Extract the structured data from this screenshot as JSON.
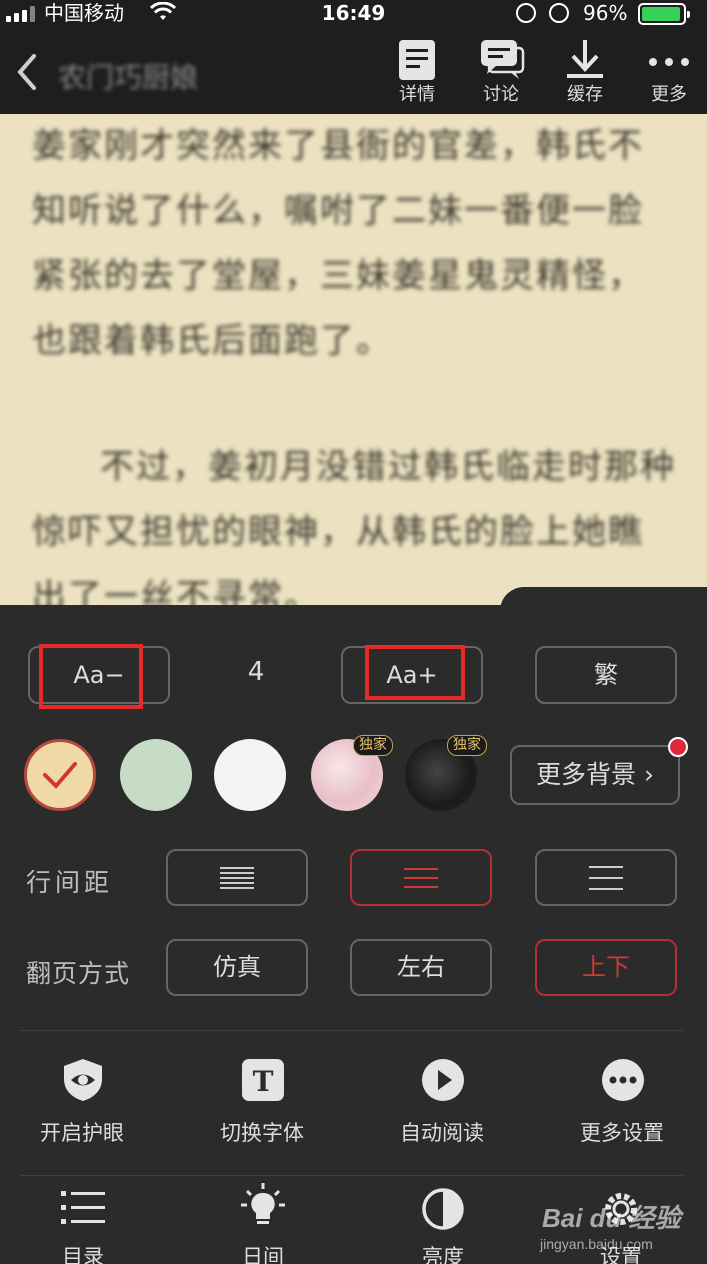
{
  "status_bar": {
    "carrier": "中国移动",
    "time": "16:49",
    "battery_percent_text": "96%",
    "battery_level": 0.96
  },
  "navbar": {
    "title": "农门巧厨娘",
    "actions": [
      {
        "icon": "details-icon",
        "label": "详情"
      },
      {
        "icon": "discussion-icon",
        "label": "讨论"
      },
      {
        "icon": "download-icon",
        "label": "缓存"
      },
      {
        "icon": "more-icon",
        "label": "更多"
      }
    ]
  },
  "page": {
    "paragraphs": [
      "姜家刚才突然来了县衙的官差，韩氏不知听说了什么，嘱咐了二妹一番便一脸紧张的去了堂屋，三妹姜星鬼灵精怪，也跟着韩氏后面跑了。",
      "不过，姜初月没错过韩氏临走时那种惊吓又担忧的眼神，从韩氏的脸上她瞧出了一丝不寻常。"
    ]
  },
  "font_size": {
    "decrease_label": "Aa−",
    "value": "4",
    "increase_label": "Aa+",
    "traditional_label": "繁"
  },
  "backgrounds": {
    "swatches": [
      {
        "name": "parchment",
        "color": "#efd9a7",
        "selected": true
      },
      {
        "name": "green",
        "color": "#c7dcc6",
        "selected": false
      },
      {
        "name": "white",
        "color": "#f4f4f4",
        "selected": false
      },
      {
        "name": "pink-floral",
        "color": "#f2d4d8",
        "selected": false,
        "badge": "独家"
      },
      {
        "name": "dark",
        "color": "#242424",
        "selected": false,
        "badge": "独家"
      }
    ],
    "more_label": "更多背景",
    "more_chevron": "›"
  },
  "line_spacing": {
    "label": "行间距",
    "options": [
      "compact",
      "medium",
      "loose"
    ],
    "selected": "medium"
  },
  "page_turn": {
    "label": "翻页方式",
    "options": [
      "仿真",
      "左右",
      "上下"
    ],
    "selected": "上下"
  },
  "tools": [
    {
      "icon": "eye-protection-icon",
      "label": "开启护眼"
    },
    {
      "icon": "font-switch-icon",
      "label": "切换字体"
    },
    {
      "icon": "auto-read-icon",
      "label": "自动阅读"
    },
    {
      "icon": "more-settings-icon",
      "label": "更多设置"
    }
  ],
  "bottom_nav": [
    {
      "icon": "catalog-icon",
      "label": "目录"
    },
    {
      "icon": "day-mode-icon",
      "label": "日间"
    },
    {
      "icon": "brightness-icon",
      "label": "亮度"
    },
    {
      "icon": "settings-icon",
      "label": "设置"
    }
  ],
  "watermark": {
    "brand": "Bai du 经验",
    "url": "jingyan.baidu.com"
  },
  "colors": {
    "accent": "#d03a34",
    "panel_bg": "#2b2b2b",
    "page_bg": "#ece2c2"
  }
}
